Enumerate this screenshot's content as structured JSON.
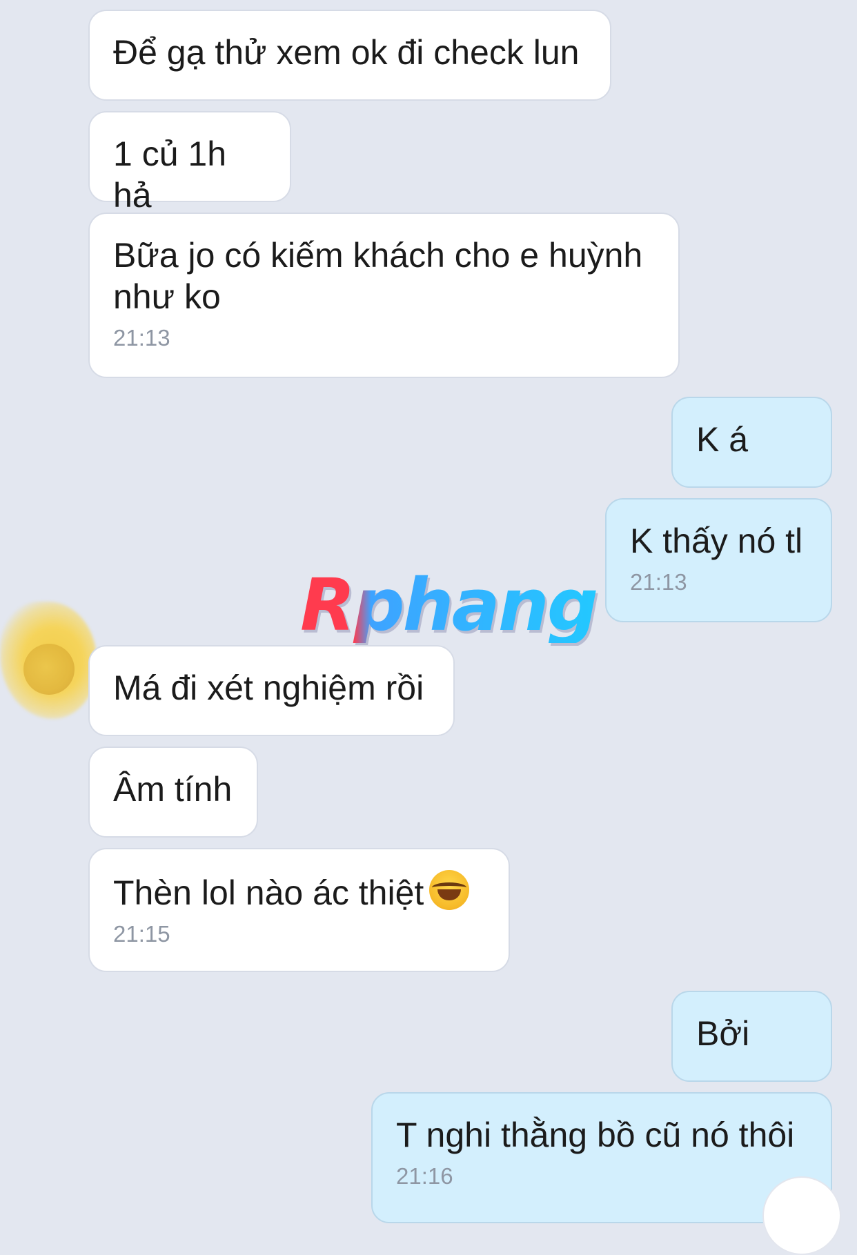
{
  "messages": [
    {
      "side": "in",
      "text": "Để gạ thử xem ok đi check lun",
      "time": ""
    },
    {
      "side": "in",
      "text": "1 củ 1h hả",
      "time": ""
    },
    {
      "side": "in",
      "text": "Bữa jo có kiếm khách cho e huỳnh\nnhư ko",
      "time": "21:13"
    },
    {
      "side": "out",
      "text": "K á",
      "time": ""
    },
    {
      "side": "out",
      "text": "K thấy nó tl",
      "time": "21:13"
    },
    {
      "side": "in",
      "text": "Má đi xét nghiệm rồi",
      "time": ""
    },
    {
      "side": "in",
      "text": "Âm tính",
      "time": ""
    },
    {
      "side": "in",
      "text": "Thèn lol nào ác thiệt",
      "emoji": "face-with-tears-of-joy",
      "time": "21:15"
    },
    {
      "side": "out",
      "text": "Bởi",
      "time": ""
    },
    {
      "side": "out",
      "text": "T nghi thằng bồ cũ nó thôi",
      "time": "21:16"
    }
  ],
  "watermark": "Rphang",
  "colors": {
    "background": "#e3e7f0",
    "incoming": "#ffffff",
    "outgoing": "#d3effd",
    "time": "#8e96a3"
  }
}
